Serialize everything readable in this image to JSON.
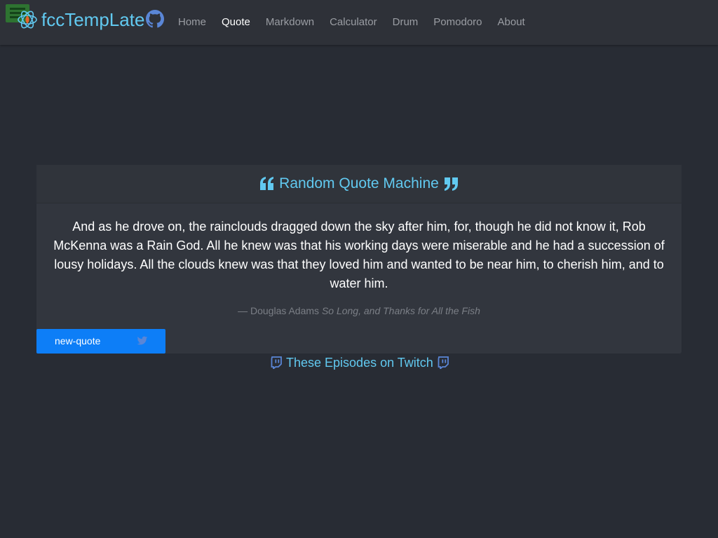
{
  "app": {
    "brand": "fccTempLate",
    "menu_icon": "hamburger-menu-icon",
    "brand_icon": "react-fire-icon",
    "github_icon": "github-icon"
  },
  "nav": {
    "items": [
      {
        "label": "Home",
        "active": false
      },
      {
        "label": "Quote",
        "active": true
      },
      {
        "label": "Markdown",
        "active": false
      },
      {
        "label": "Calculator",
        "active": false
      },
      {
        "label": "Drum",
        "active": false
      },
      {
        "label": "Pomodoro",
        "active": false
      },
      {
        "label": "About",
        "active": false
      }
    ]
  },
  "quote_card": {
    "title": "Random Quote Machine",
    "text": "And as he drove on, the rainclouds dragged down the sky after him, for, though he did not know it, Rob McKenna was a Rain God. All he knew was that his working days were miserable and he had a succession of lousy holidays. All the clouds knew was that they loved him and wanted to be near him, to cherish him, and to water him.",
    "author": "— Douglas Adams",
    "source": "So Long, and Thanks for All the Fish",
    "new_quote_label": "new-quote",
    "tweet_icon": "twitter-icon"
  },
  "twitch": {
    "label": "These Episodes on Twitch",
    "icon": "twitch-icon"
  },
  "colors": {
    "background": "#282c34",
    "navbar": "#2e3138",
    "card": "#32363e",
    "accent": "#61c9f0",
    "button": "#0d7ef7"
  }
}
